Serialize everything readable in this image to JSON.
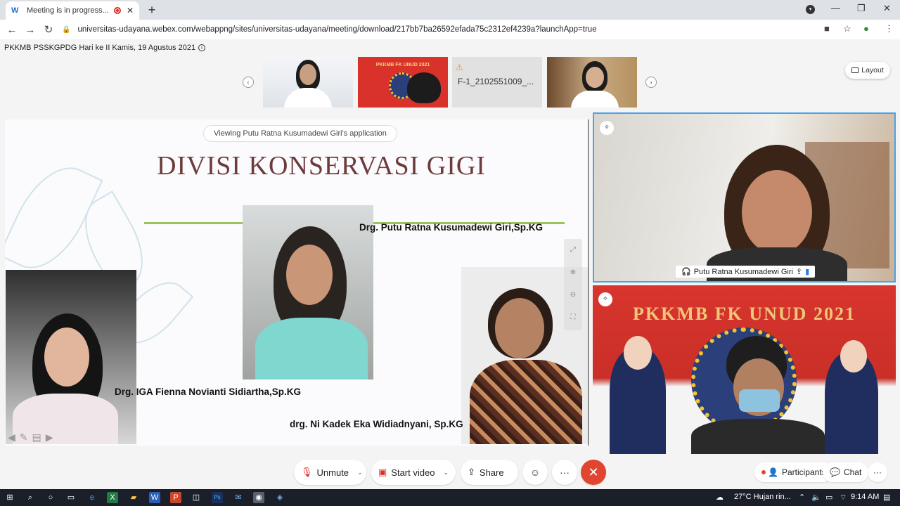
{
  "browser": {
    "tab_title": "Meeting is in progress...",
    "tab_favicon": "W",
    "url": "universitas-udayana.webex.com/webappng/sites/universitas-udayana/meeting/download/217bb7ba26592efada75c2312ef4239a?launchApp=true"
  },
  "meeting": {
    "title": "PKKMB PSSKGPDG Hari ke II Kamis, 19 Agustus 2021",
    "layout_label": "Layout",
    "thumbnails": [
      {
        "type": "video"
      },
      {
        "type": "video",
        "banner": "PKKMB FK UNUD 2021"
      },
      {
        "type": "file",
        "filename": "F-1_2102551009_..."
      },
      {
        "type": "video"
      }
    ]
  },
  "share": {
    "viewing_label": "Viewing Putu Ratna Kusumadewi Giri's application",
    "slide_title": "DIVISI KONSERVASI GIGI",
    "captions": {
      "top": "Drg. Putu Ratna Kusumadewi Giri,Sp.KG",
      "left": "Drg. IGA Fienna Novianti Sidiartha,Sp.KG",
      "right": "drg. Ni Kadek Eka Widiadnyani, Sp.KG"
    }
  },
  "videos": {
    "speaker_name": "Putu Ratna Kusumadewi Giri",
    "second_banner": "PKKMB FK UNUD 2021"
  },
  "controls": {
    "unmute": "Unmute",
    "start_video": "Start video",
    "share": "Share",
    "participants": "Participants",
    "chat": "Chat",
    "more": "···"
  },
  "taskbar": {
    "weather": "27°C  Hujan rin...",
    "time": "9:14 AM"
  },
  "colors": {
    "accent": "#4aa3e8",
    "end_call": "#e0452f",
    "title": "#6e3b3b",
    "line": "#9bc35b"
  }
}
